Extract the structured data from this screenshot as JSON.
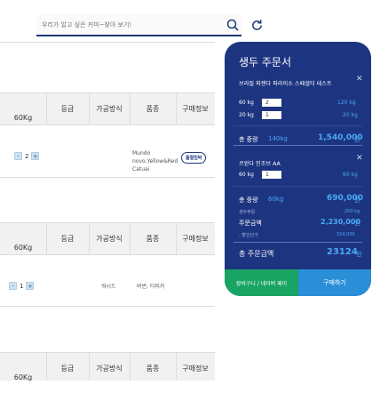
{
  "search": {
    "placeholder": "우리가 알고 싶은 커피~찾아 보기!"
  },
  "table": {
    "headers": [
      "60Kg",
      "등급",
      "가공방식",
      "품종",
      "구매정보"
    ]
  },
  "rows": [
    {
      "qty": "2",
      "variety": "Mundo novo,Yellow&Red Catuai",
      "badge": "품절임박"
    },
    {
      "qty": "1",
      "process": "워시드",
      "variety": "버번, 티피카"
    }
  ],
  "panel": {
    "title": "생두 주문서",
    "item1": {
      "name": "브라질 파젠다 파라이소 스페셜티 테스트",
      "lines": [
        {
          "unit": "60 kg",
          "qty": "2",
          "weight": "120 kg"
        },
        {
          "unit": "20 kg",
          "qty": "1",
          "weight": "20 kg"
        }
      ],
      "total_label": "총 중량",
      "total_weight": "140kg",
      "total_price": "1,540,000",
      "won": "원"
    },
    "item2": {
      "name": "르완다 인조브 AA",
      "lines": [
        {
          "unit": "60 kg",
          "qty": "1",
          "weight": "60 kg"
        }
      ],
      "total_label": "총 중량",
      "total_weight": "60kg",
      "total_price": "690,000",
      "won": "원"
    },
    "summary": {
      "beans_label": "생두주문",
      "beans_value": "200 kg",
      "order_label": "주문금액",
      "order_value": "2,230,000",
      "won": "원",
      "discount_label": "- 할인단가",
      "discount_value": "154,000",
      "grand_label": "총 주문금액",
      "grand_value": "23124",
      "grand_won": "원"
    },
    "buttons": {
      "cart": "장바구니 / 네이버 페이",
      "buy": "구매하기"
    }
  },
  "icons": [
    "search-icon",
    "refresh-icon",
    "close-icon"
  ],
  "colors": {
    "panel": "#1d3580",
    "accent": "#4aa9f5",
    "green": "#19a463",
    "buy": "#2b8fd8"
  }
}
